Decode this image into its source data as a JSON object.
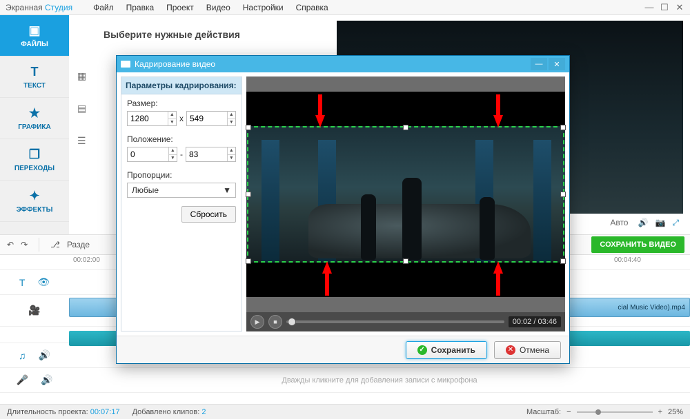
{
  "app": {
    "name1": "Экранная",
    "name2": "Студия"
  },
  "menu": {
    "file": "Файл",
    "edit": "Правка",
    "project": "Проект",
    "video": "Видео",
    "settings": "Настройки",
    "help": "Справка"
  },
  "sidebar": {
    "files": "ФАЙЛЫ",
    "text": "ТЕКСТ",
    "graphics": "ГРАФИКА",
    "transitions": "ПЕРЕХОДЫ",
    "effects": "ЭФФЕКТЫ"
  },
  "center": {
    "title": "Выберите нужные действия"
  },
  "toolbar": {
    "split": "Разде",
    "save_video": "СОХРАНИТЬ ВИДЕО"
  },
  "preview": {
    "auto": "Авто"
  },
  "ruler": {
    "t1": "00:02:00",
    "t2": "00:04:40"
  },
  "tracks": {
    "clip_name": "cial Music Video).mp4",
    "mic_hint": "Дважды кликните для добавления записи с микрофона"
  },
  "status": {
    "duration_label": "Длительность проекта:",
    "duration_value": "00:07:17",
    "clips_label": "Добавлено клипов:",
    "clips_value": "2",
    "zoom_label": "Масштаб:",
    "zoom_value": "25%"
  },
  "dialog": {
    "title": "Кадрирование видео",
    "params_header": "Параметры кадрирования:",
    "size_label": "Размер:",
    "size_w": "1280",
    "size_sep": "x",
    "size_h": "549",
    "pos_label": "Положение:",
    "pos_x": "0",
    "pos_sep": "-",
    "pos_y": "83",
    "ratio_label": "Пропорции:",
    "ratio_value": "Любые",
    "reset": "Сбросить",
    "time": "00:02 / 03:46",
    "save": "Сохранить",
    "cancel": "Отмена"
  }
}
